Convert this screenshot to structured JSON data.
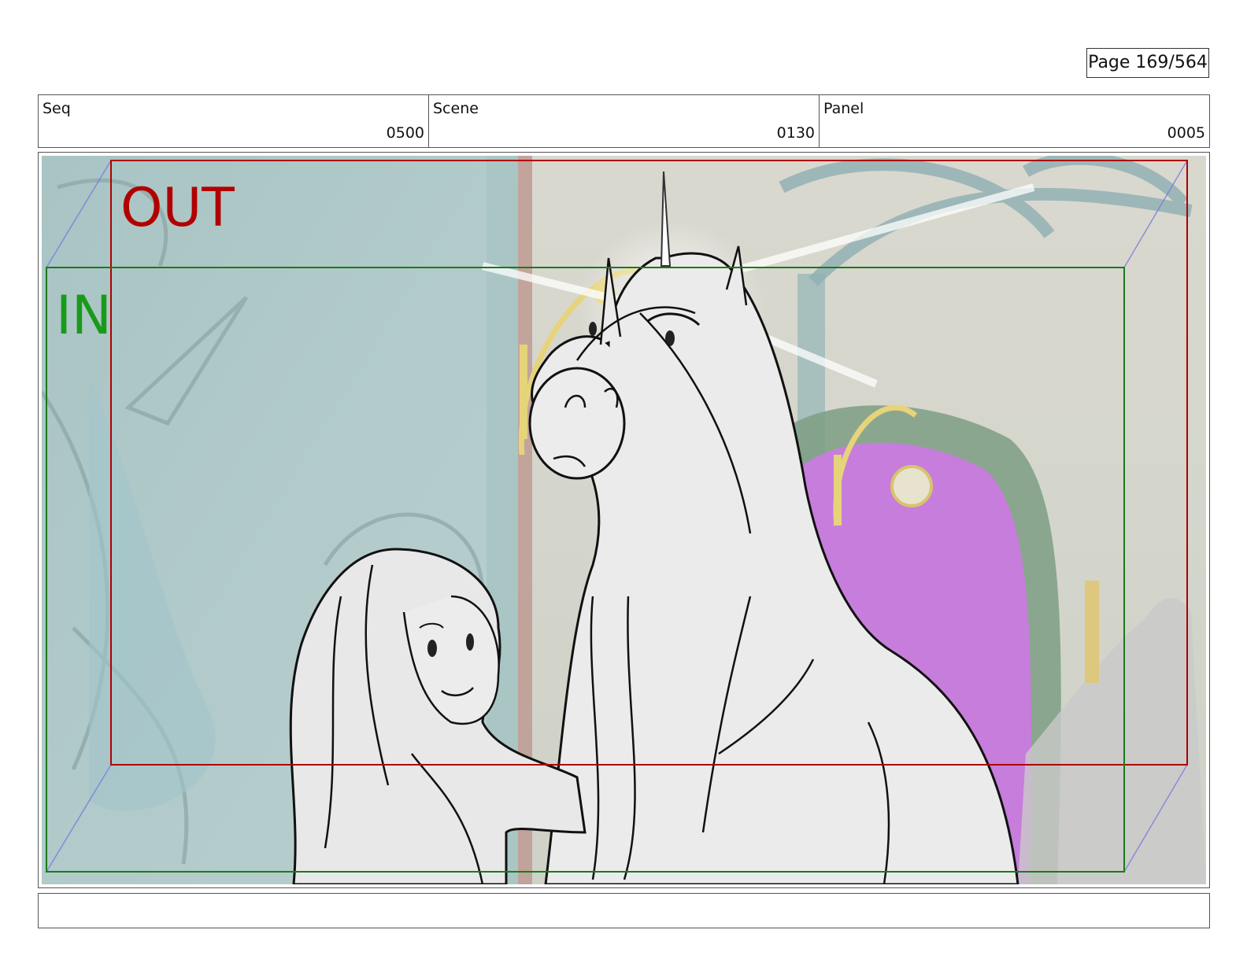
{
  "page": {
    "label": "Page 169/564"
  },
  "header": {
    "seq_label": "Seq",
    "seq_value": "0500",
    "scene_label": "Scene",
    "scene_value": "0130",
    "panel_label": "Panel",
    "panel_value": "0005"
  },
  "panel": {
    "out_frame_label": "OUT",
    "in_frame_label": "IN",
    "out_color": "#b00000",
    "in_color": "#1a9a1a"
  },
  "caption": {
    "text": ""
  }
}
